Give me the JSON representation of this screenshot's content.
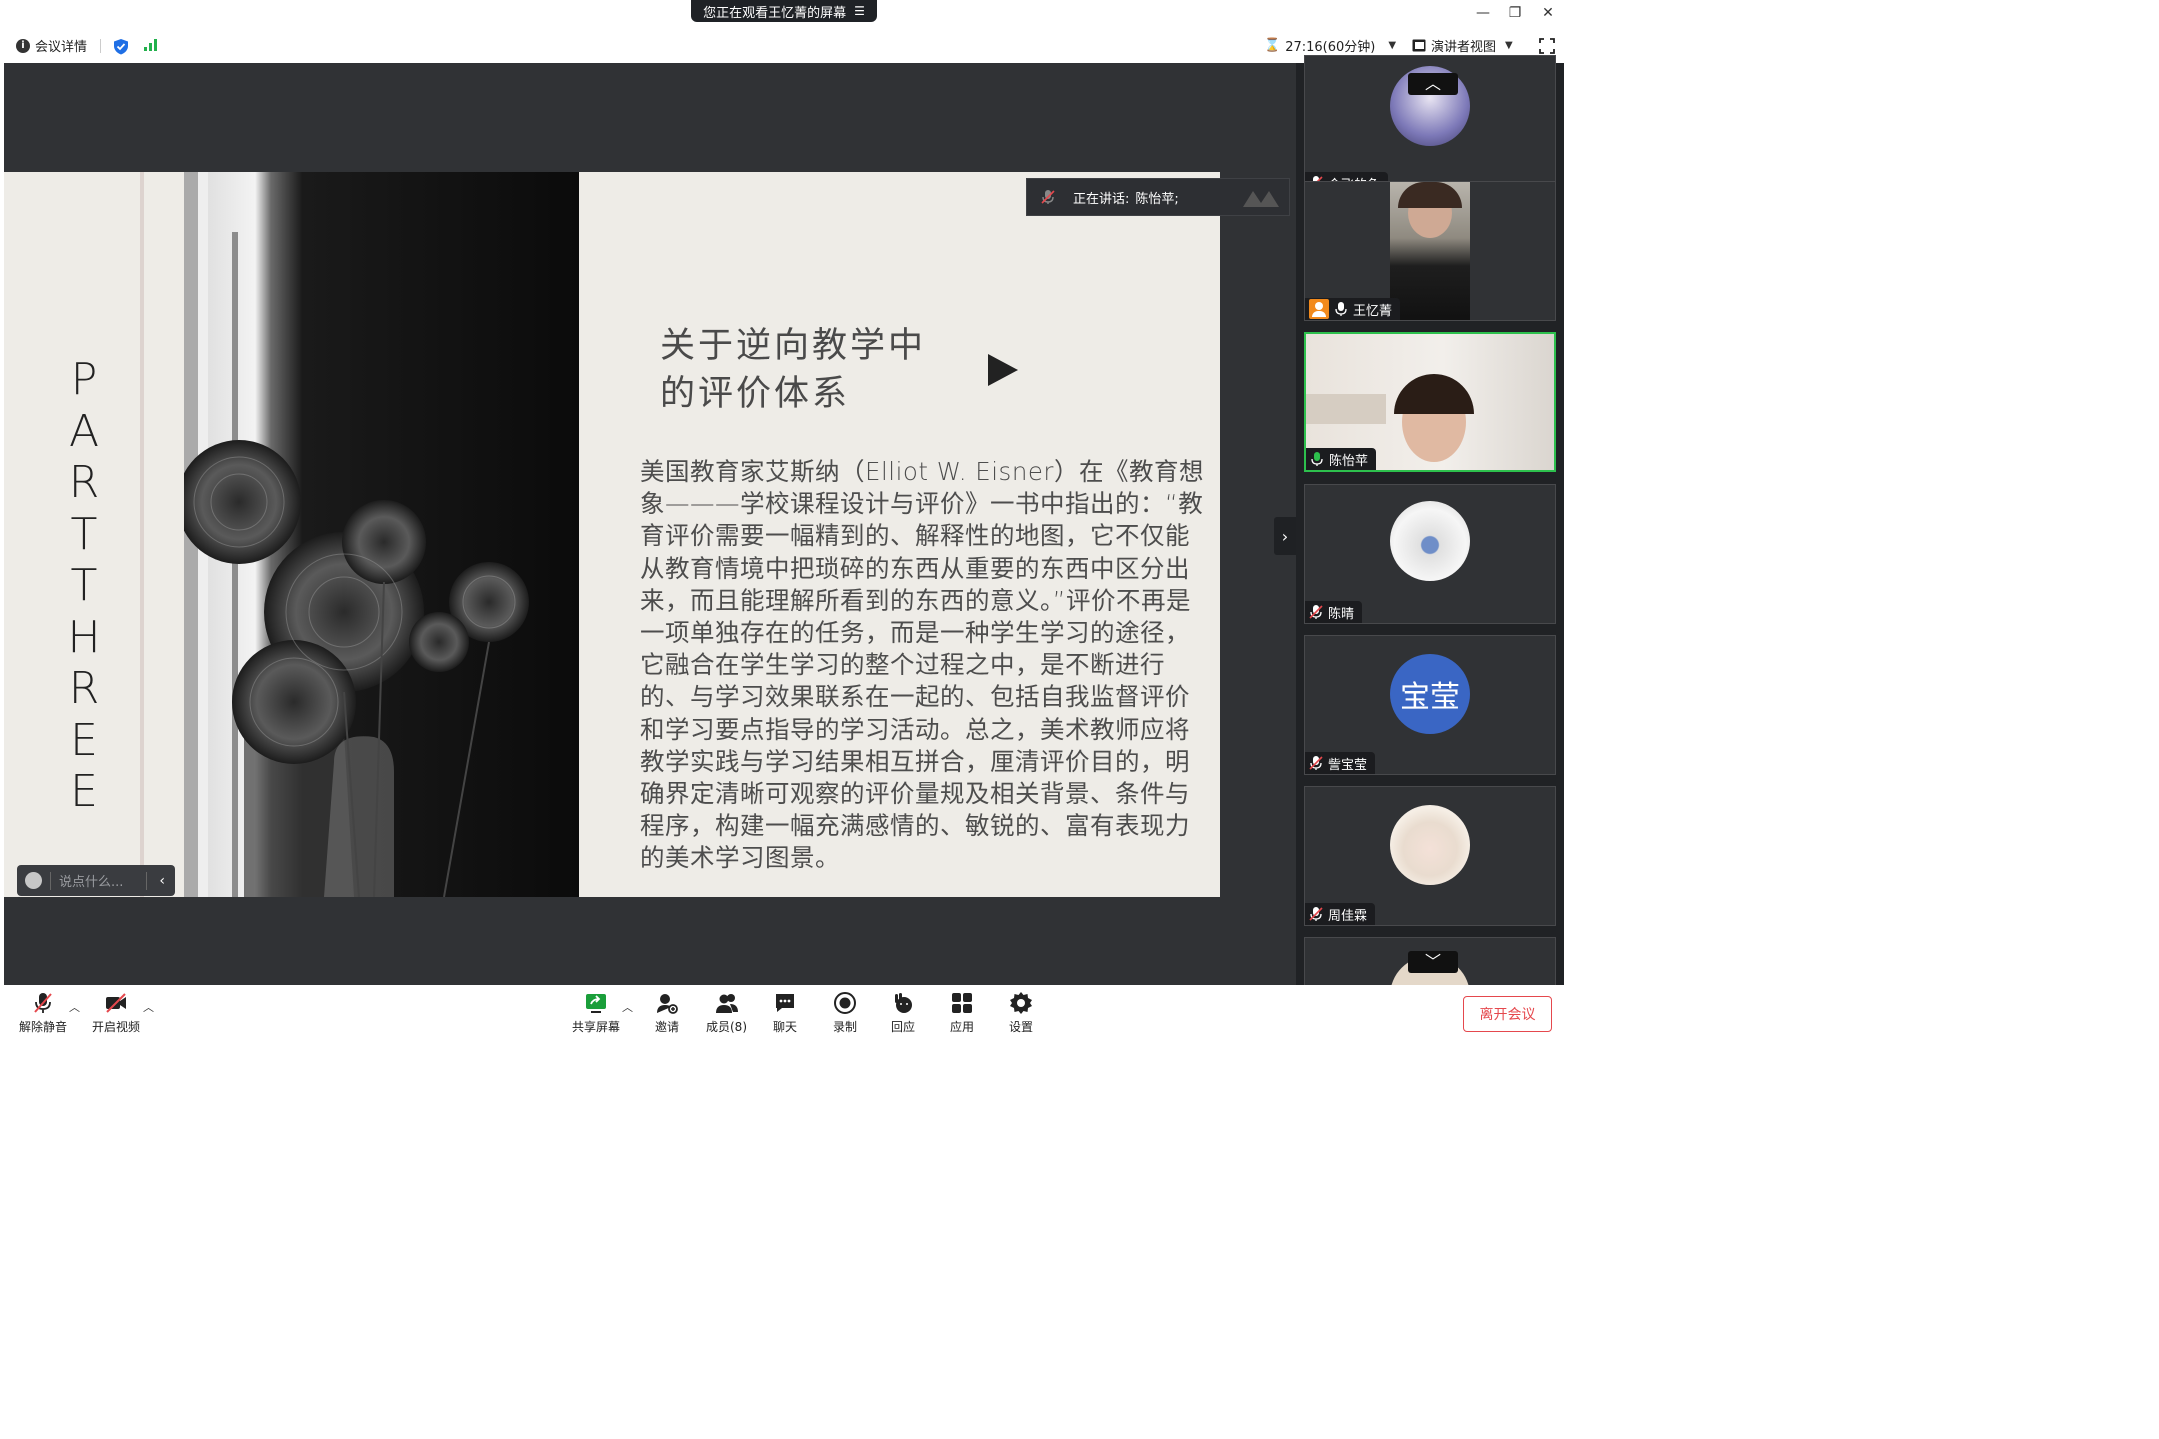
{
  "window": {
    "banner_text": "您正在观看王忆菁的屏幕",
    "banner_menu_icon": "menu-lines-icon"
  },
  "topbar": {
    "meeting_info": "会议详情",
    "timer": "27:16(60分钟)",
    "view_mode": "演讲者视图"
  },
  "slide": {
    "vertical_text": [
      "P",
      "A",
      "R",
      "T",
      "T",
      "H",
      "R",
      "E",
      "E"
    ],
    "title": "关于逆向教学中\n的评价体系",
    "body": "美国教育家艾斯纳（Elliot W. Eisner）在《教育想象———学校课程设计与评价》一书中指出的：“教育评价需要一幅精到的、解释性的地图，它不仅能从教育情境中把琐碎的东西从重要的东西中区分出来，而且能理解所看到的东西的意义。”评价不再是一项单独存在的任务，而是一种学生学习的途径，它融合在学生学习的整个过程之中，是不断进行的、与学习效果联系在一起的、包括自我监督评价和学习要点指导的学习活动。总之，美术教师应将教学实践与学习结果相互拼合，厘清评价目的，明确界定清晰可观察的评价量规及相关背景、条件与程序，构建一幅充满感情的、敏锐的、富有表现力的美术学习图景。"
  },
  "speaking": {
    "label": "正在讲话:",
    "name": "陈怡苹;"
  },
  "chat": {
    "placeholder": "说点什么..."
  },
  "participants": [
    {
      "name": "会飞的鱼",
      "mic": "muted",
      "avatar": "photo"
    },
    {
      "name": "王忆菁",
      "mic": "on",
      "host": true,
      "avatar": "video"
    },
    {
      "name": "陈怡苹",
      "mic": "on",
      "active": true,
      "avatar": "video"
    },
    {
      "name": "陈晴",
      "mic": "muted",
      "avatar": "photo"
    },
    {
      "name": "訾宝莹",
      "mic": "muted",
      "avatar": "text",
      "avatar_text": "宝莹",
      "avatar_color": "#3a66c4"
    },
    {
      "name": "周佳霖",
      "mic": "muted",
      "avatar": "photo"
    }
  ],
  "toolbar": {
    "unmute": "解除静音",
    "video": "开启视频",
    "share": "共享屏幕",
    "invite": "邀请",
    "members": "成员(8)",
    "chat": "聊天",
    "record": "录制",
    "reaction": "回应",
    "apps": "应用",
    "settings": "设置",
    "leave": "离开会议"
  },
  "colors": {
    "accent_green": "#2dc04d",
    "leave_red": "#e5484d",
    "stage_bg": "#303235",
    "panel_bg": "#202225"
  }
}
